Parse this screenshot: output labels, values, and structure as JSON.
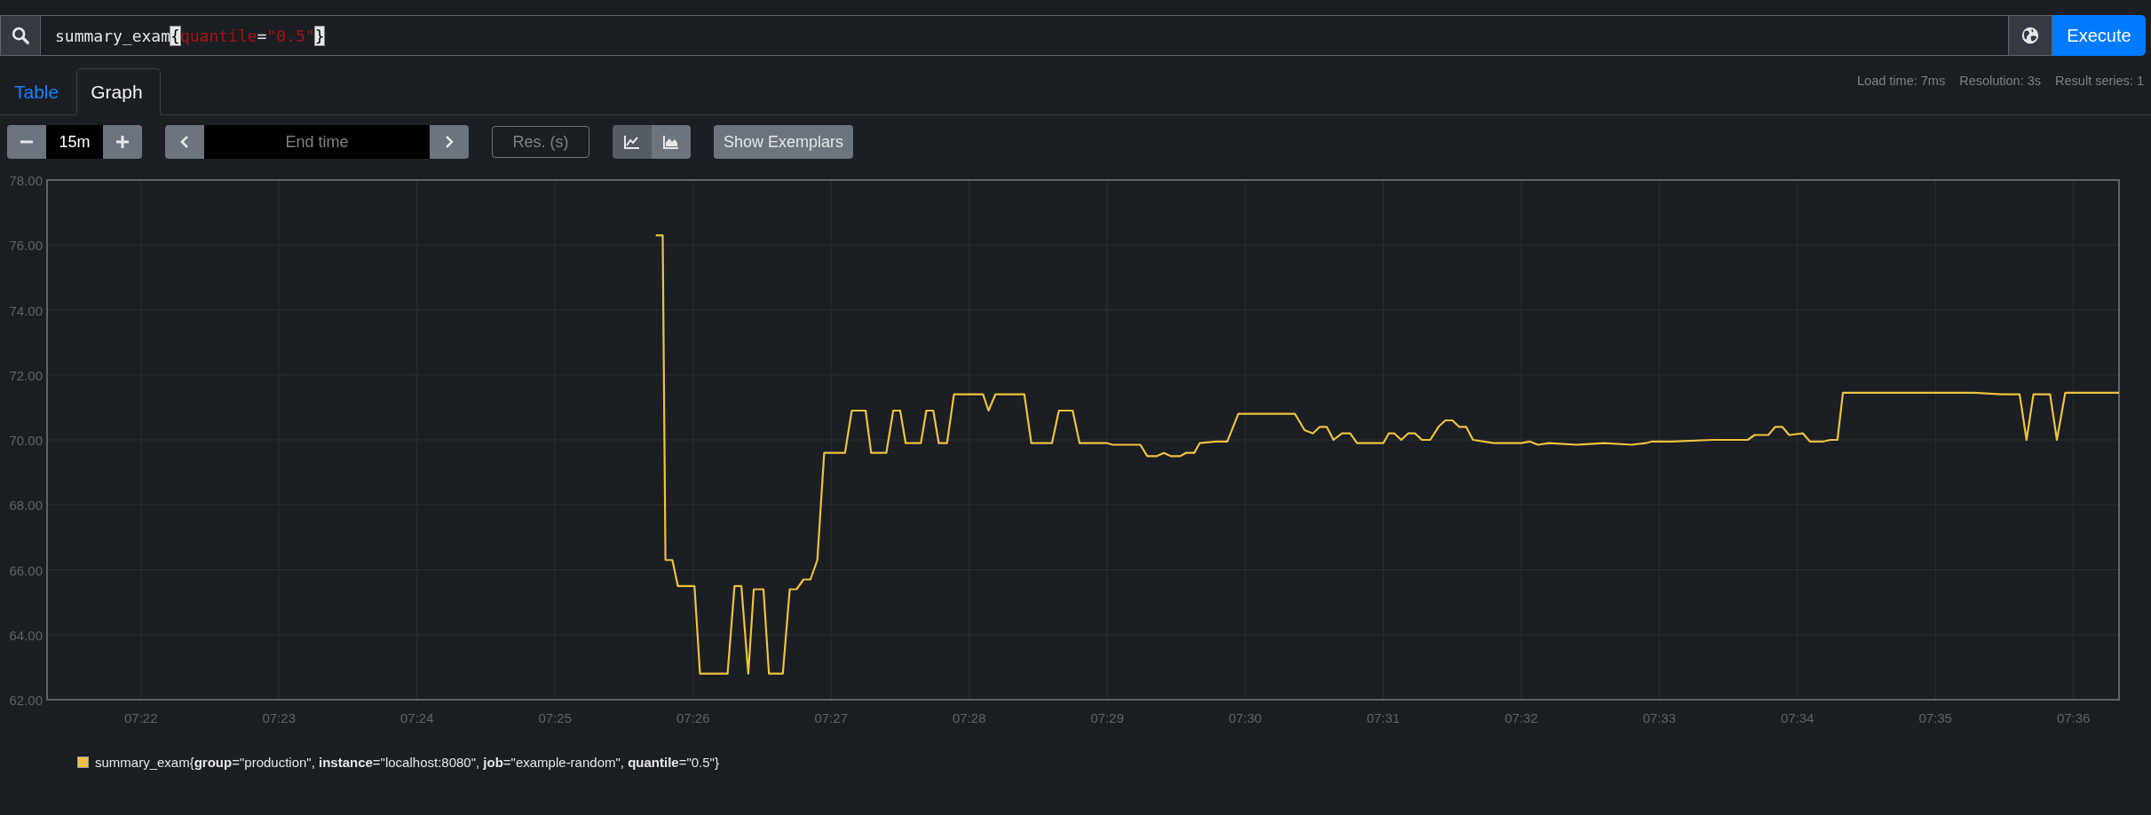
{
  "query": {
    "tokens": [
      {
        "kind": "ident",
        "text": "summary_exam"
      },
      {
        "kind": "bracket",
        "text": "{",
        "matched": true
      },
      {
        "kind": "label",
        "text": "quantile"
      },
      {
        "kind": "op",
        "text": "="
      },
      {
        "kind": "string",
        "text": "\"0.5\""
      },
      {
        "kind": "bracket",
        "text": "}",
        "matched": true
      }
    ]
  },
  "execute_button": "Execute",
  "tabs": [
    {
      "label": "Table",
      "selected": false
    },
    {
      "label": "Graph",
      "selected": true
    }
  ],
  "stats": [
    "Load time: 7ms",
    "Resolution: 3s",
    "Result series: 1"
  ],
  "range": {
    "value": "15m"
  },
  "end_time": {
    "placeholder": "End time"
  },
  "resolution": {
    "placeholder": "Res. (s)"
  },
  "chart_modes": [
    {
      "kind": "line",
      "selected": true
    },
    {
      "kind": "stacked",
      "selected": false
    }
  ],
  "exemplars_button": "Show Exemplars",
  "graph": {
    "chart_data": {
      "type": "line",
      "grid": true,
      "xlim": [
        441.32,
        456.33
      ],
      "ylim": [
        62,
        78
      ],
      "xticks": [
        {
          "value": 442,
          "label": "07:22"
        },
        {
          "value": 443,
          "label": "07:23"
        },
        {
          "value": 444,
          "label": "07:24"
        },
        {
          "value": 445,
          "label": "07:25"
        },
        {
          "value": 446,
          "label": "07:26"
        },
        {
          "value": 447,
          "label": "07:27"
        },
        {
          "value": 448,
          "label": "07:28"
        },
        {
          "value": 449,
          "label": "07:29"
        },
        {
          "value": 450,
          "label": "07:30"
        },
        {
          "value": 451,
          "label": "07:31"
        },
        {
          "value": 452,
          "label": "07:32"
        },
        {
          "value": 453,
          "label": "07:33"
        },
        {
          "value": 454,
          "label": "07:34"
        },
        {
          "value": 455,
          "label": "07:35"
        },
        {
          "value": 456,
          "label": "07:36"
        }
      ],
      "yticks": [
        {
          "value": 62,
          "label": "62.00"
        },
        {
          "value": 64,
          "label": "64.00"
        },
        {
          "value": 66,
          "label": "66.00"
        },
        {
          "value": 68,
          "label": "68.00"
        },
        {
          "value": 70,
          "label": "70.00"
        },
        {
          "value": 72,
          "label": "72.00"
        },
        {
          "value": 74,
          "label": "74.00"
        },
        {
          "value": 76,
          "label": "76.00"
        },
        {
          "value": 78,
          "label": "78.00"
        }
      ],
      "x": [
        445.73,
        445.78,
        445.8,
        445.85,
        445.89,
        446.01,
        446.05,
        446.25,
        446.3,
        446.35,
        446.4,
        446.44,
        446.51,
        446.55,
        446.65,
        446.7,
        446.75,
        446.8,
        446.85,
        446.9,
        446.95,
        447.1,
        447.15,
        447.25,
        447.29,
        447.4,
        447.45,
        447.5,
        447.54,
        447.65,
        447.69,
        447.74,
        447.78,
        447.84,
        447.89,
        448.1,
        448.14,
        448.19,
        448.4,
        448.45,
        448.6,
        448.65,
        448.75,
        448.8,
        449.0,
        449.04,
        449.24,
        449.29,
        449.36,
        449.41,
        449.46,
        449.53,
        449.57,
        449.63,
        449.67,
        449.79,
        449.87,
        449.95,
        450.36,
        450.43,
        450.49,
        450.54,
        450.59,
        450.64,
        450.7,
        450.76,
        450.81,
        451.0,
        451.04,
        451.08,
        451.13,
        451.18,
        451.23,
        451.28,
        451.34,
        451.4,
        451.45,
        451.5,
        451.55,
        451.6,
        451.65,
        451.8,
        452.0,
        452.06,
        452.12,
        452.2,
        452.4,
        452.6,
        452.8,
        452.9,
        452.95,
        453.09,
        453.39,
        453.64,
        453.69,
        453.79,
        453.84,
        453.89,
        453.94,
        454.04,
        454.09,
        454.19,
        454.24,
        454.29,
        454.33,
        455.28,
        455.48,
        455.61,
        455.66,
        455.71,
        455.83,
        455.88,
        455.94,
        456.33
      ],
      "series": [
        {
          "name": "summary_exam{**group**=\"production\", **instance**=\"localhost:8080\", **job**=\"example-random\", **quantile**=\"0.5\"}",
          "color": "#edc240",
          "values": [
            76.3,
            76.3,
            66.3,
            66.3,
            65.5,
            65.5,
            62.8,
            62.8,
            65.5,
            65.5,
            62.8,
            65.4,
            65.4,
            62.8,
            62.8,
            65.4,
            65.4,
            65.7,
            65.7,
            66.3,
            69.6,
            69.6,
            70.9,
            70.9,
            69.6,
            69.6,
            70.9,
            70.9,
            69.9,
            69.9,
            70.9,
            70.9,
            69.9,
            69.9,
            71.4,
            71.4,
            70.9,
            71.4,
            71.4,
            69.9,
            69.9,
            70.9,
            70.9,
            69.9,
            69.9,
            69.85,
            69.85,
            69.5,
            69.5,
            69.6,
            69.5,
            69.5,
            69.6,
            69.6,
            69.9,
            69.95,
            69.95,
            70.8,
            70.8,
            70.3,
            70.2,
            70.4,
            70.4,
            70.0,
            70.2,
            70.2,
            69.9,
            69.9,
            70.2,
            70.2,
            70.0,
            70.2,
            70.2,
            70.0,
            70.0,
            70.4,
            70.6,
            70.6,
            70.4,
            70.4,
            70.0,
            69.9,
            69.9,
            69.95,
            69.85,
            69.9,
            69.85,
            69.9,
            69.85,
            69.9,
            69.95,
            69.95,
            70.0,
            70.0,
            70.15,
            70.15,
            70.4,
            70.4,
            70.15,
            70.2,
            69.95,
            69.95,
            70.0,
            70.0,
            71.45,
            71.45,
            71.4,
            71.4,
            70.0,
            71.4,
            71.4,
            70.0,
            71.45,
            71.45
          ]
        }
      ]
    }
  }
}
